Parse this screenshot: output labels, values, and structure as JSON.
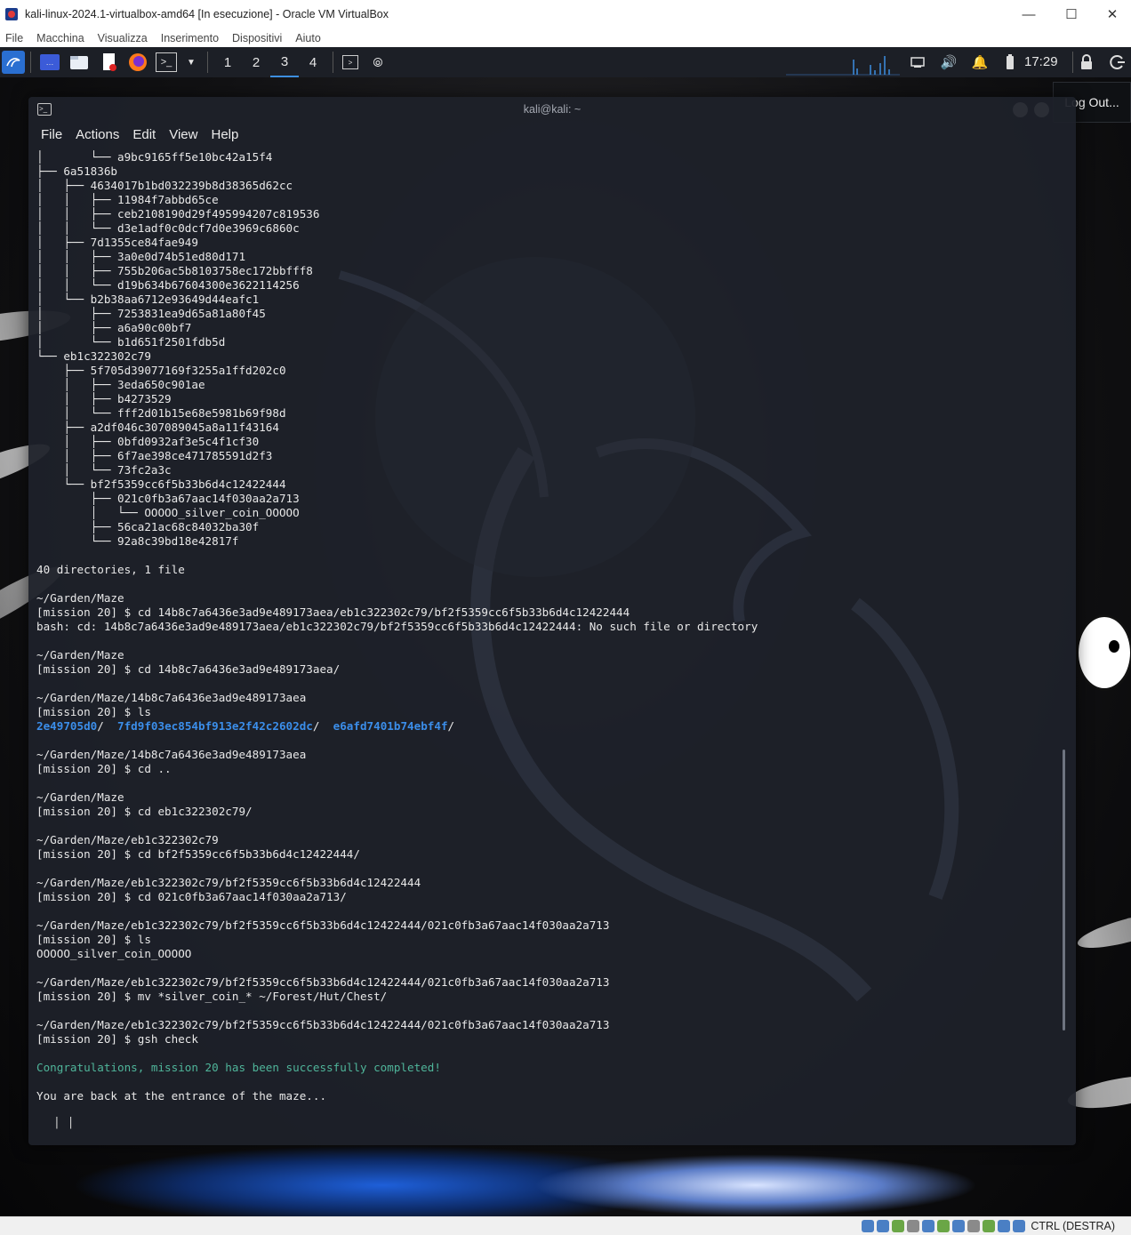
{
  "vbox": {
    "title": "kali-linux-2024.1-virtualbox-amd64 [In esecuzione] - Oracle VM VirtualBox",
    "menu": [
      "File",
      "Macchina",
      "Visualizza",
      "Inserimento",
      "Dispositivi",
      "Aiuto"
    ],
    "window_controls": {
      "minimize": "—",
      "maximize": "☐",
      "close": "✕"
    },
    "host_key_label": "CTRL (DESTRA)"
  },
  "panel": {
    "workspaces": [
      "1",
      "2",
      "3",
      "4"
    ],
    "active_workspace": "3",
    "clock": "17:29",
    "icons": [
      "kali-menu-icon",
      "desktop-icon",
      "file-manager-icon",
      "text-editor-icon",
      "firefox-icon",
      "terminal-icon",
      "chevron-down-icon",
      "terminal-launcher-icon",
      "binoculars-icon",
      "network-icon",
      "volume-icon",
      "notifications-icon",
      "battery-icon",
      "lock-icon",
      "logout-icon"
    ]
  },
  "logout_tooltip": "Log Out...",
  "terminal": {
    "title": "kali@kali: ~",
    "menu": [
      "File",
      "Actions",
      "Edit",
      "View",
      "Help"
    ],
    "lines": [
      {
        "t": "│       └── a9bc9165ff5e10bc42a15f4"
      },
      {
        "t": "├── 6a51836b"
      },
      {
        "t": "│   ├── 4634017b1bd032239b8d38365d62cc"
      },
      {
        "t": "│   │   ├── 11984f7abbd65ce"
      },
      {
        "t": "│   │   ├── ceb2108190d29f495994207c819536"
      },
      {
        "t": "│   │   └── d3e1adf0c0dcf7d0e3969c6860c"
      },
      {
        "t": "│   ├── 7d1355ce84fae949"
      },
      {
        "t": "│   │   ├── 3a0e0d74b51ed80d171"
      },
      {
        "t": "│   │   ├── 755b206ac5b8103758ec172bbfff8"
      },
      {
        "t": "│   │   └── d19b634b67604300e3622114256"
      },
      {
        "t": "│   └── b2b38aa6712e93649d44eafc1"
      },
      {
        "t": "│       ├── 7253831ea9d65a81a80f45"
      },
      {
        "t": "│       ├── a6a90c00bf7"
      },
      {
        "t": "│       └── b1d651f2501fdb5d"
      },
      {
        "t": "└── eb1c322302c79"
      },
      {
        "t": "    ├── 5f705d39077169f3255a1ffd202c0"
      },
      {
        "t": "    │   ├── 3eda650c901ae"
      },
      {
        "t": "    │   ├── b4273529"
      },
      {
        "t": "    │   └── fff2d01b15e68e5981b69f98d"
      },
      {
        "t": "    ├── a2df046c307089045a8a11f43164"
      },
      {
        "t": "    │   ├── 0bfd0932af3e5c4f1cf30"
      },
      {
        "t": "    │   ├── 6f7ae398ce471785591d2f3"
      },
      {
        "t": "    │   └── 73fc2a3c"
      },
      {
        "t": "    └── bf2f5359cc6f5b33b6d4c12422444"
      },
      {
        "t": "        ├── 021c0fb3a67aac14f030aa2a713"
      },
      {
        "t": "        │   └── OOOOO_silver_coin_OOOOO"
      },
      {
        "t": "        ├── 56ca21ac68c84032ba30f"
      },
      {
        "t": "        └── 92a8c39bd18e42817f"
      },
      {
        "t": ""
      },
      {
        "t": "40 directories, 1 file"
      },
      {
        "t": ""
      },
      {
        "t": "~/Garden/Maze"
      },
      {
        "t": "[mission 20] $ cd 14b8c7a6436e3ad9e489173aea/eb1c322302c79/bf2f5359cc6f5b33b6d4c12422444"
      },
      {
        "t": "bash: cd: 14b8c7a6436e3ad9e489173aea/eb1c322302c79/bf2f5359cc6f5b33b6d4c12422444: No such file or directory"
      },
      {
        "t": ""
      },
      {
        "t": "~/Garden/Maze"
      },
      {
        "t": "[mission 20] $ cd 14b8c7a6436e3ad9e489173aea/"
      },
      {
        "t": ""
      },
      {
        "t": "~/Garden/Maze/14b8c7a6436e3ad9e489173aea"
      },
      {
        "t": "[mission 20] $ ls"
      },
      {
        "t": "LS_DIRS"
      },
      {
        "t": ""
      },
      {
        "t": "~/Garden/Maze/14b8c7a6436e3ad9e489173aea"
      },
      {
        "t": "[mission 20] $ cd .."
      },
      {
        "t": ""
      },
      {
        "t": "~/Garden/Maze"
      },
      {
        "t": "[mission 20] $ cd eb1c322302c79/"
      },
      {
        "t": ""
      },
      {
        "t": "~/Garden/Maze/eb1c322302c79"
      },
      {
        "t": "[mission 20] $ cd bf2f5359cc6f5b33b6d4c12422444/"
      },
      {
        "t": ""
      },
      {
        "t": "~/Garden/Maze/eb1c322302c79/bf2f5359cc6f5b33b6d4c12422444"
      },
      {
        "t": "[mission 20] $ cd 021c0fb3a67aac14f030aa2a713/"
      },
      {
        "t": ""
      },
      {
        "t": "~/Garden/Maze/eb1c322302c79/bf2f5359cc6f5b33b6d4c12422444/021c0fb3a67aac14f030aa2a713"
      },
      {
        "t": "[mission 20] $ ls"
      },
      {
        "t": "OOOOO_silver_coin_OOOOO"
      },
      {
        "t": ""
      },
      {
        "t": "~/Garden/Maze/eb1c322302c79/bf2f5359cc6f5b33b6d4c12422444/021c0fb3a67aac14f030aa2a713"
      },
      {
        "t": "[mission 20] $ mv *silver_coin_* ~/Forest/Hut/Chest/"
      },
      {
        "t": ""
      },
      {
        "t": "~/Garden/Maze/eb1c322302c79/bf2f5359cc6f5b33b6d4c12422444/021c0fb3a67aac14f030aa2a713"
      },
      {
        "t": "[mission 20] $ gsh check"
      },
      {
        "t": ""
      },
      {
        "t": "Congratulations, mission 20 has been successfully completed!",
        "cls": "success"
      },
      {
        "t": ""
      },
      {
        "t": "You are back at the entrance of the maze..."
      }
    ],
    "ls_dirs": [
      "2e49705d0",
      "7fd9f03ec854bf913e2f42c2602dc",
      "e6afd7401b74ebf4f"
    ],
    "prompt_cursor": "|                                    |"
  },
  "colors": {
    "accent": "#3d8fe0",
    "dir": "#3b8eea",
    "success": "#4fb59a"
  }
}
